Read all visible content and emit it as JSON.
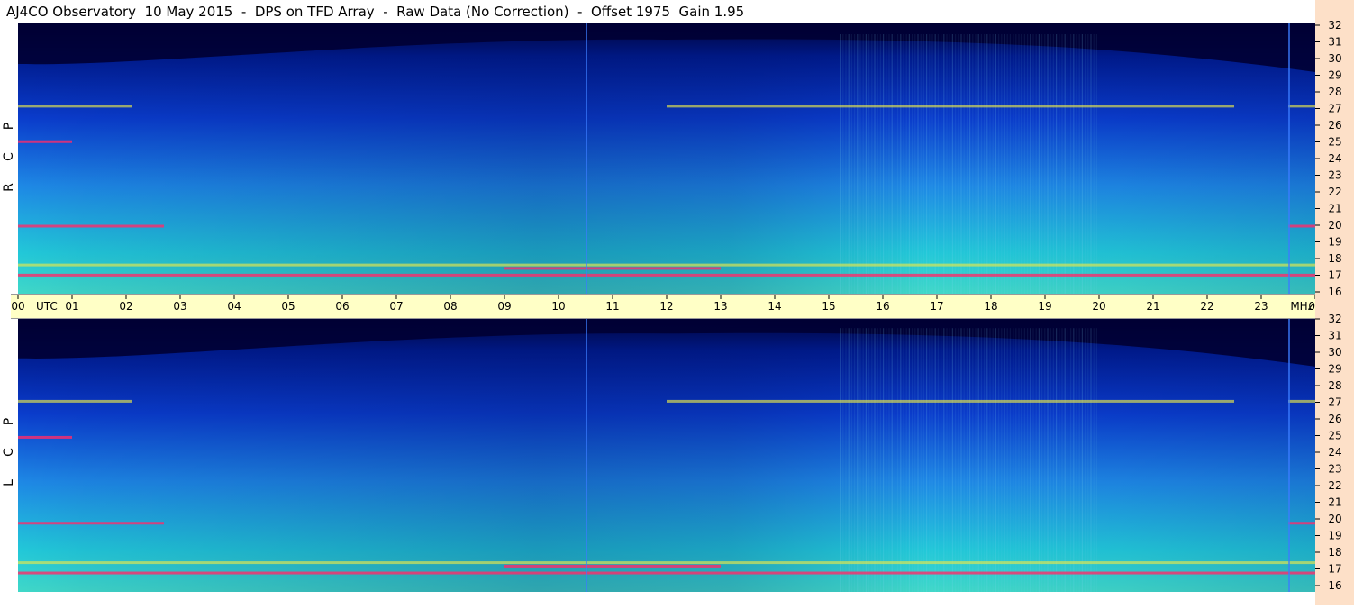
{
  "title": "AJ4CO Observatory  10 May 2015  -  DPS on TFD Array  -  Raw Data (No Correction)  -  Offset 1975  Gain 1.95",
  "panels": {
    "rcp_label": [
      "R",
      "C",
      "P"
    ],
    "lcp_label": [
      "L",
      "C",
      "P"
    ]
  },
  "time_axis": {
    "labels": [
      "00",
      "01",
      "02",
      "03",
      "04",
      "05",
      "06",
      "07",
      "08",
      "09",
      "10",
      "11",
      "12",
      "13",
      "14",
      "15",
      "16",
      "17",
      "18",
      "19",
      "20",
      "21",
      "22",
      "23",
      "00"
    ],
    "unit": "UTC",
    "freq_unit": "MHz"
  },
  "freq_axis": {
    "ticks": [
      32,
      31,
      30,
      29,
      28,
      27,
      26,
      25,
      24,
      23,
      22,
      21,
      20,
      19,
      18,
      17,
      16
    ]
  },
  "colors": {
    "low": "#000033",
    "mid_low": "#0a3ccc",
    "mid": "#1e88e5",
    "mid_high": "#22c8d8",
    "high": "#e8e84a",
    "peak": "#ff2a6a",
    "time_axis_bg": "#ffffc6",
    "freq_axis_bg": "#fde0c8"
  },
  "chart_data": {
    "type": "heatmap",
    "title": "AJ4CO Observatory  10 May 2015  -  DPS on TFD Array  -  Raw Data (No Correction)  -  Offset 1975  Gain 1.95",
    "xlabel": "UTC",
    "ylabel": "MHz",
    "xlim": [
      0,
      24
    ],
    "ylim": [
      16,
      32
    ],
    "panels": [
      "RCP",
      "LCP"
    ],
    "bands_mhz": [
      {
        "freq": 27.1,
        "start_h": 0.0,
        "end_h": 2.1,
        "level": "high"
      },
      {
        "freq": 27.1,
        "start_h": 12.0,
        "end_h": 22.5,
        "level": "high"
      },
      {
        "freq": 27.1,
        "start_h": 23.5,
        "end_h": 24.0,
        "level": "high"
      },
      {
        "freq": 25.0,
        "start_h": 0.0,
        "end_h": 1.0,
        "level": "peak"
      },
      {
        "freq": 20.0,
        "start_h": 0.0,
        "end_h": 2.7,
        "level": "peak"
      },
      {
        "freq": 20.0,
        "start_h": 23.5,
        "end_h": 24.0,
        "level": "peak"
      },
      {
        "freq": 17.7,
        "start_h": 0.0,
        "end_h": 24.0,
        "level": "high"
      },
      {
        "freq": 17.5,
        "start_h": 9.0,
        "end_h": 13.0,
        "level": "peak"
      },
      {
        "freq": 17.1,
        "start_h": 0.0,
        "end_h": 24.0,
        "level": "peak"
      }
    ]
  }
}
